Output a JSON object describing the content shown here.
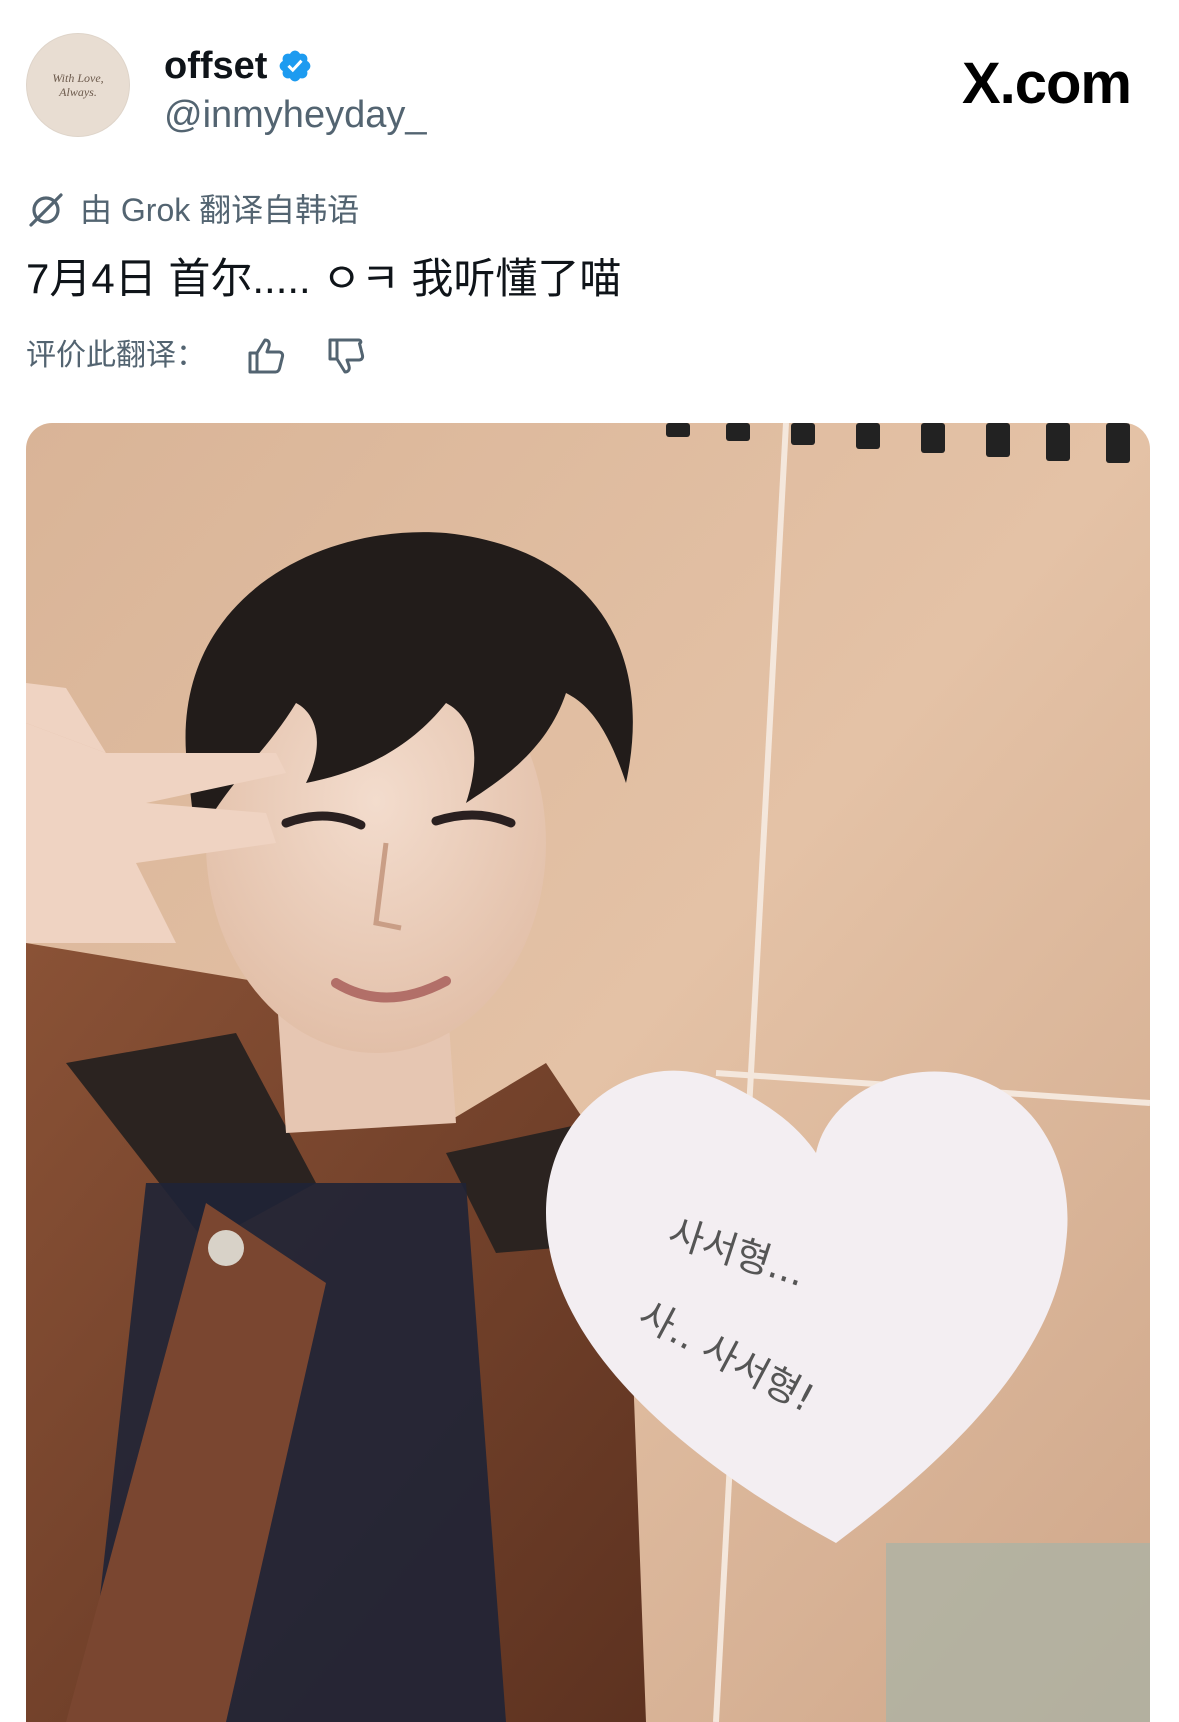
{
  "author": {
    "display_name": "offset",
    "handle": "@inmyheyday_",
    "verified": true,
    "avatar_text": [
      "With Love,",
      "Always."
    ]
  },
  "brand": {
    "label": "X.com"
  },
  "translation": {
    "label": "由 Grok 翻译自韩语",
    "text": "7月4日 首尔..... ㅇㅋ 我听懂了喵",
    "rate_label": "评价此翻译：",
    "icons": [
      "grok-translate-icon",
      "thumbs-up-icon",
      "thumbs-down-icon"
    ]
  },
  "media": {
    "note_lines": [
      "사서형...",
      "사.. 사서형!"
    ]
  },
  "colors": {
    "accent_blue": "#1d9bf0",
    "secondary_text": "#536471",
    "primary_text": "#0f1419"
  }
}
